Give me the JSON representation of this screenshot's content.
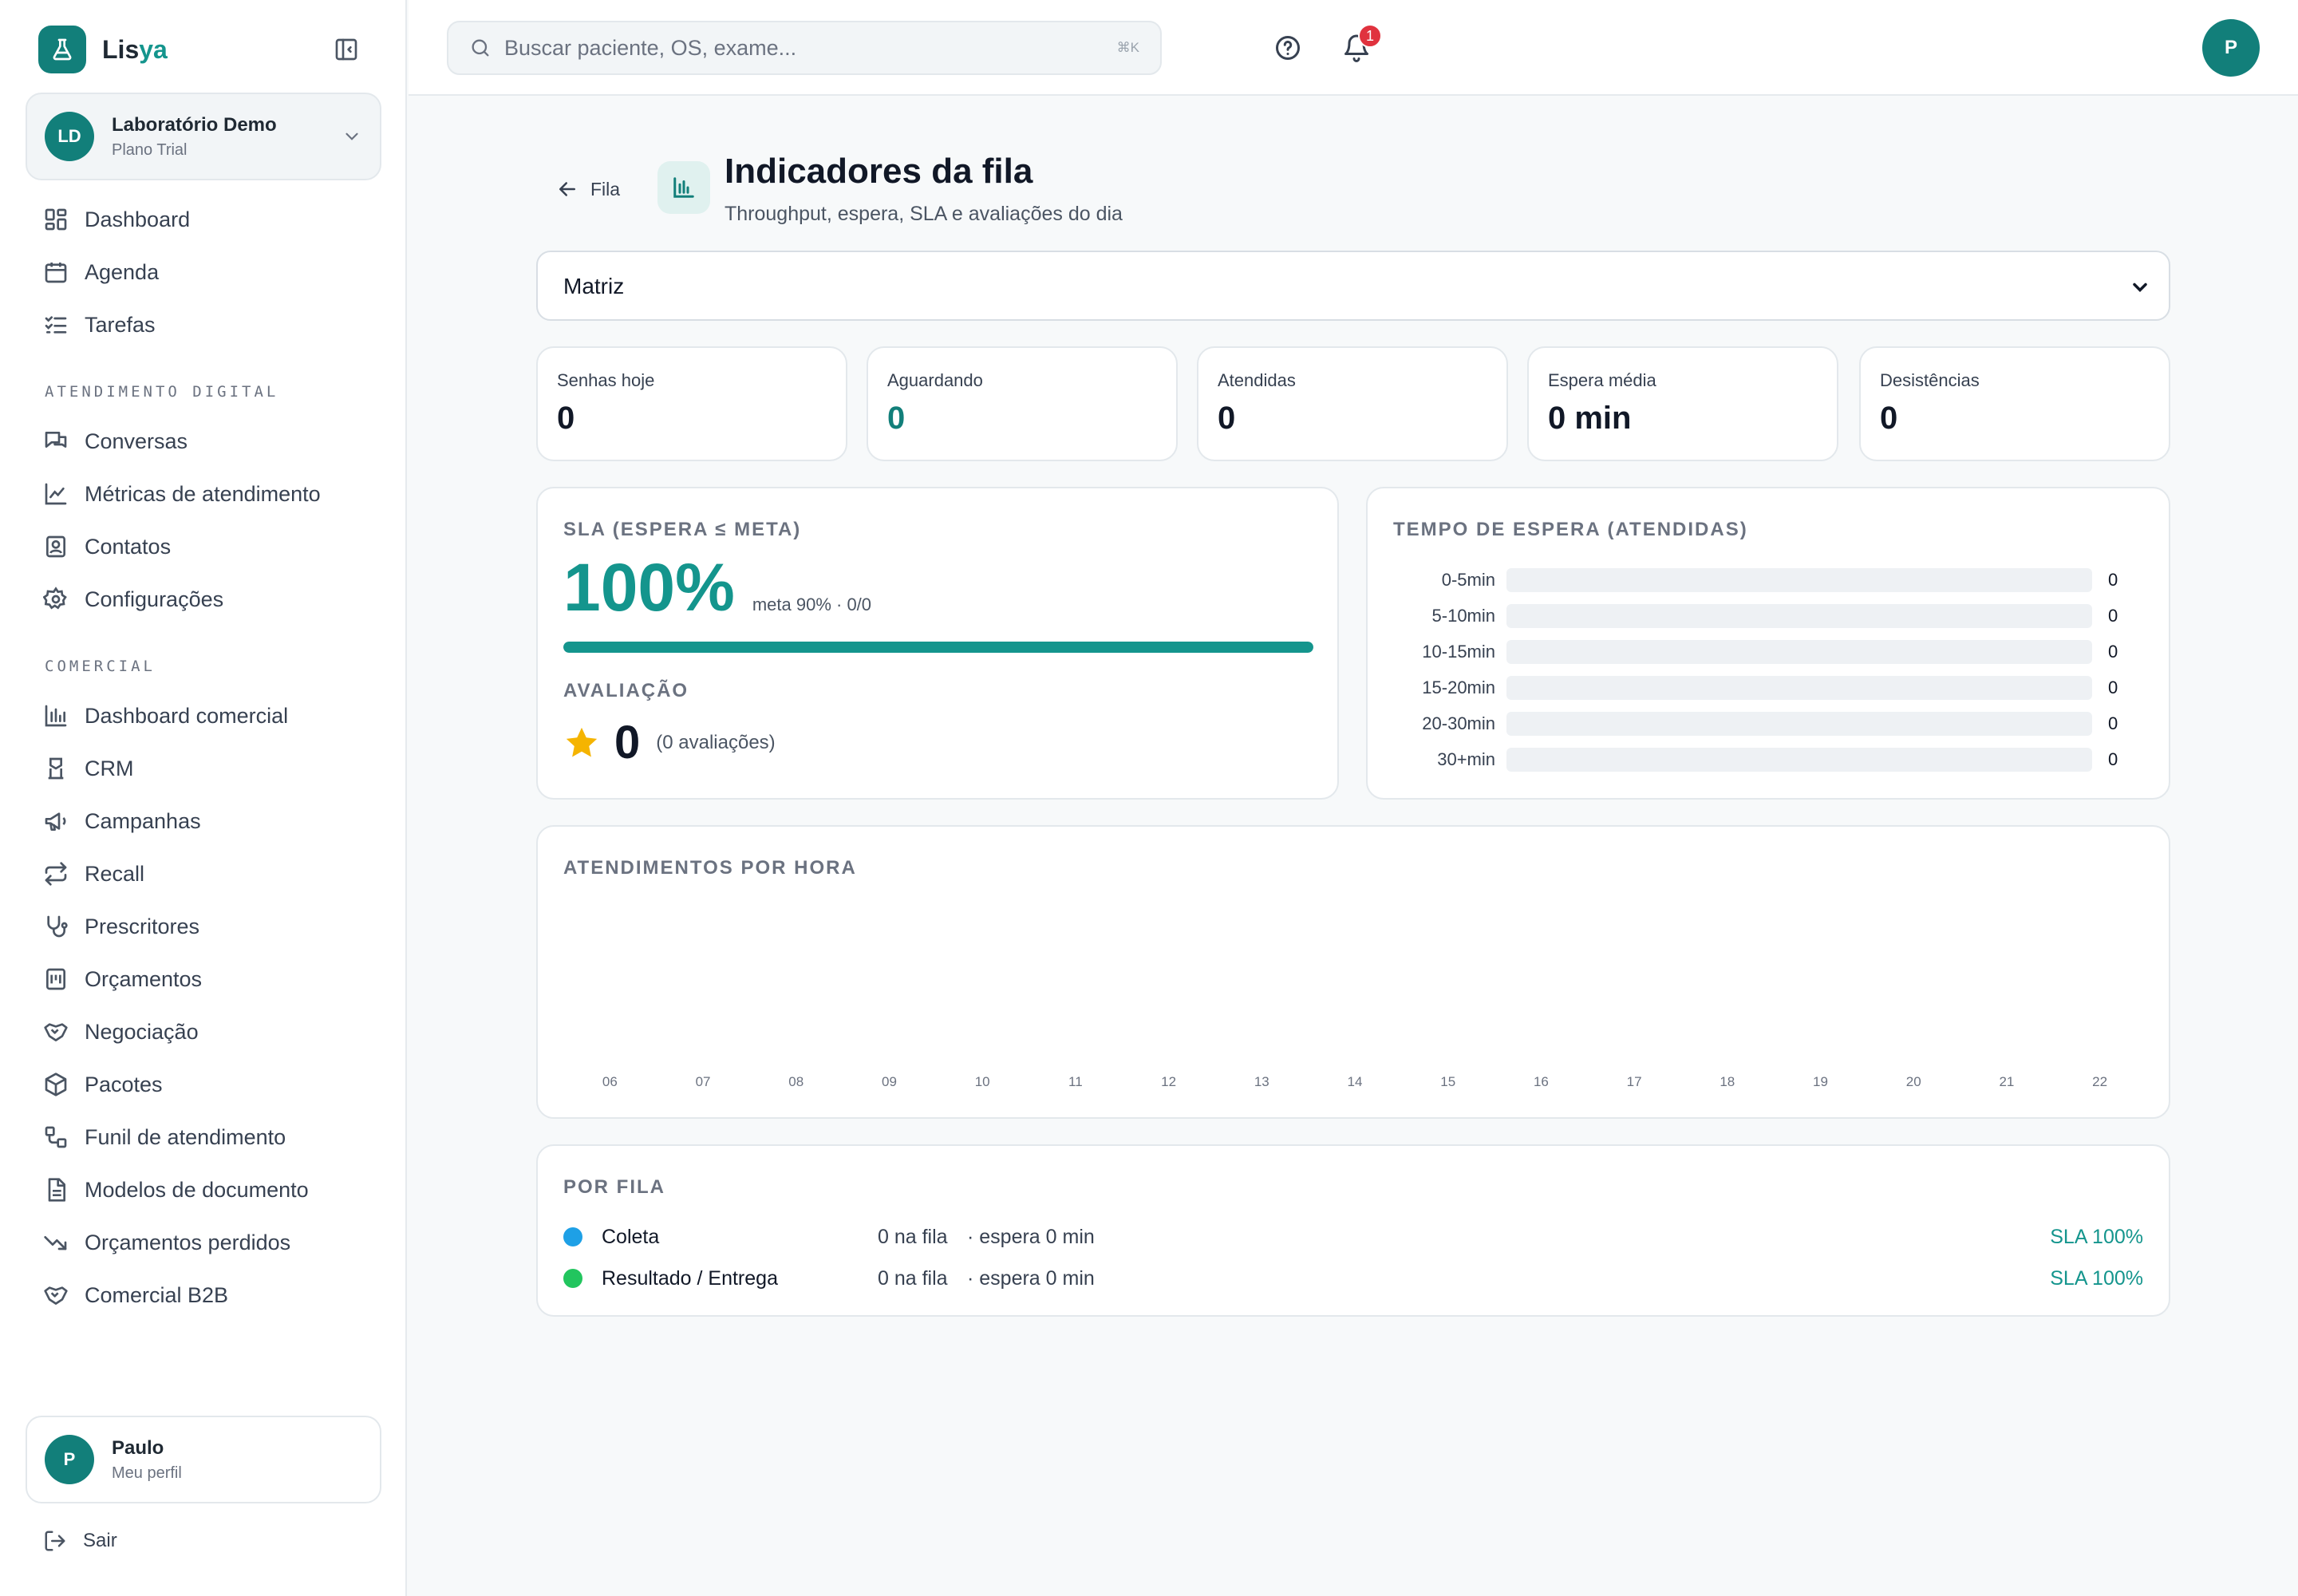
{
  "colors": {
    "accent": "#14958d",
    "brand": "#127f7a",
    "badge": "#e0323e",
    "star": "#f5b400"
  },
  "brand": {
    "name_part1": "Lis",
    "name_part2": "ya",
    "logo_icon": "flask-icon"
  },
  "org": {
    "initials": "LD",
    "name": "Laboratório Demo",
    "plan": "Plano Trial"
  },
  "nav": {
    "main": [
      {
        "label": "Dashboard",
        "icon": "dashboard-icon"
      },
      {
        "label": "Agenda",
        "icon": "calendar-icon"
      },
      {
        "label": "Tarefas",
        "icon": "tasks-icon"
      }
    ],
    "section_digital": "ATENDIMENTO DIGITAL",
    "digital": [
      {
        "label": "Conversas",
        "icon": "chat-icon"
      },
      {
        "label": "Métricas de atendimento",
        "icon": "line-chart-icon"
      },
      {
        "label": "Contatos",
        "icon": "contacts-icon"
      },
      {
        "label": "Configurações",
        "icon": "gear-icon"
      }
    ],
    "section_comercial": "COMERCIAL",
    "comercial": [
      {
        "label": "Dashboard comercial",
        "icon": "bar-chart-icon"
      },
      {
        "label": "CRM",
        "icon": "crm-icon"
      },
      {
        "label": "Campanhas",
        "icon": "megaphone-icon"
      },
      {
        "label": "Recall",
        "icon": "repeat-icon"
      },
      {
        "label": "Prescritores",
        "icon": "stethoscope-icon"
      },
      {
        "label": "Orçamentos",
        "icon": "quote-icon"
      },
      {
        "label": "Negociação",
        "icon": "handshake-icon"
      },
      {
        "label": "Pacotes",
        "icon": "package-icon"
      },
      {
        "label": "Funil de atendimento",
        "icon": "funnel-icon"
      },
      {
        "label": "Modelos de documento",
        "icon": "document-icon"
      },
      {
        "label": "Orçamentos perdidos",
        "icon": "trending-down-icon"
      },
      {
        "label": "Comercial B2B",
        "icon": "handshake-icon"
      }
    ]
  },
  "profile": {
    "initial": "P",
    "name": "Paulo",
    "subtitle": "Meu perfil"
  },
  "logout_label": "Sair",
  "topbar": {
    "search_placeholder": "Buscar paciente, OS, exame...",
    "search_shortcut": "⌘K",
    "notifications_count": "1",
    "avatar_initial": "P"
  },
  "page": {
    "back_label": "Fila",
    "title": "Indicadores da fila",
    "subtitle": "Throughput, espera, SLA e avaliações do dia",
    "location_selected": "Matriz"
  },
  "kpis": [
    {
      "label": "Senhas hoje",
      "value": "0"
    },
    {
      "label": "Aguardando",
      "value": "0"
    },
    {
      "label": "Atendidas",
      "value": "0"
    },
    {
      "label": "Espera média",
      "value": "0 min"
    },
    {
      "label": "Desistências",
      "value": "0"
    }
  ],
  "sla": {
    "title": "SLA (ESPERA ≤ META)",
    "value": "100%",
    "meta": "meta 90% · 0/0",
    "progress": 1.0
  },
  "rating": {
    "title": "AVALIAÇÃO",
    "value": "0",
    "count": "(0 avaliações)"
  },
  "wait_hist": {
    "title": "TEMPO DE ESPERA (ATENDIDAS)",
    "buckets": [
      {
        "label": "0-5min",
        "value": 0
      },
      {
        "label": "5-10min",
        "value": 0
      },
      {
        "label": "10-15min",
        "value": 0
      },
      {
        "label": "15-20min",
        "value": 0
      },
      {
        "label": "20-30min",
        "value": 0
      },
      {
        "label": "30+min",
        "value": 0
      }
    ]
  },
  "hourly": {
    "title": "ATENDIMENTOS POR HORA"
  },
  "chart_data": {
    "type": "bar",
    "categories": [
      "06",
      "07",
      "08",
      "09",
      "10",
      "11",
      "12",
      "13",
      "14",
      "15",
      "16",
      "17",
      "18",
      "19",
      "20",
      "21",
      "22"
    ],
    "values": [
      0,
      0,
      0,
      0,
      0,
      0,
      0,
      0,
      0,
      0,
      0,
      0,
      0,
      0,
      0,
      0,
      0
    ],
    "title": "ATENDIMENTOS POR HORA",
    "xlabel": "",
    "ylabel": "",
    "grid": false
  },
  "queues": {
    "title": "POR FILA",
    "items": [
      {
        "name": "Coleta",
        "count": "0 na fila",
        "wait": "· espera 0 min",
        "sla": "SLA 100%",
        "color": "#1ea0e6"
      },
      {
        "name": "Resultado / Entrega",
        "count": "0 na fila",
        "wait": "· espera 0 min",
        "sla": "SLA 100%",
        "color": "#22c55e"
      }
    ]
  }
}
